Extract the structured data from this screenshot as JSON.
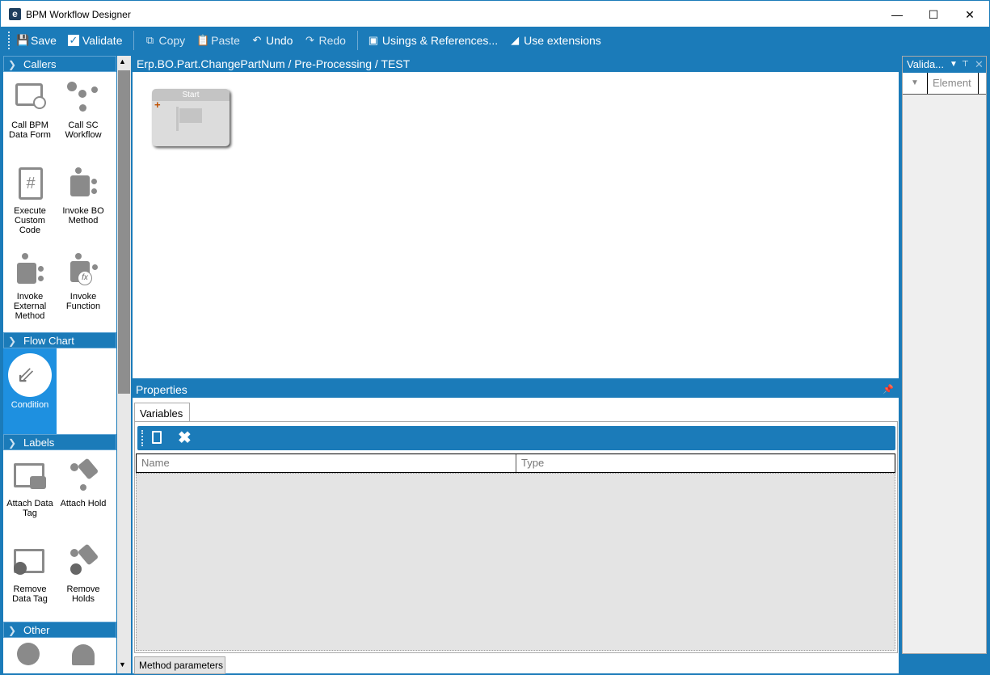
{
  "window": {
    "title": "BPM Workflow Designer",
    "logo": "e"
  },
  "toolbar": {
    "save": "Save",
    "validate": "Validate",
    "copy": "Copy",
    "paste": "Paste",
    "undo": "Undo",
    "redo": "Redo",
    "usings": "Usings & References...",
    "extensions": "Use extensions"
  },
  "toolbox": {
    "sections": [
      {
        "title": "Callers",
        "items": [
          "Call BPM Data Form",
          "Call SC Workflow",
          "Execute Custom Code",
          "Invoke BO Method",
          "Invoke External Method",
          "Invoke Function"
        ]
      },
      {
        "title": "Flow Chart",
        "items": [
          "Condition"
        ]
      },
      {
        "title": "Labels",
        "items": [
          "Attach Data Tag",
          "Attach Hold",
          "Remove Data Tag",
          "Remove Holds"
        ]
      },
      {
        "title": "Other",
        "items": []
      }
    ]
  },
  "canvas": {
    "breadcrumb": "Erp.BO.Part.ChangePartNum / Pre-Processing / TEST",
    "start_node": "Start"
  },
  "properties": {
    "title": "Properties",
    "tab": "Variables",
    "columns": [
      "Name",
      "Type"
    ],
    "bottom_tab": "Method parameters"
  },
  "validation": {
    "title": "Valida...",
    "column": "Element"
  }
}
